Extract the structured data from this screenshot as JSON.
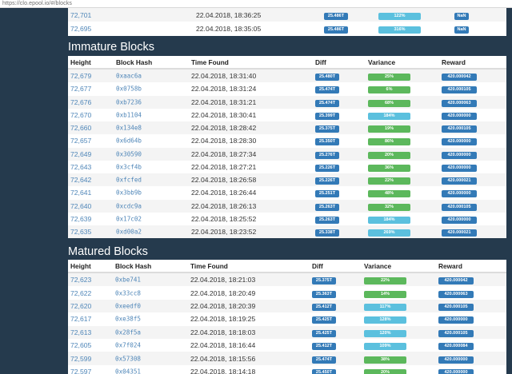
{
  "browser": {
    "url": "https://clo.epool.io/#/blocks"
  },
  "colors": {
    "variance_green": "#5cb85c",
    "variance_blue": "#5bc0de",
    "badge_blue": "#337ab7",
    "page_bg": "#253a4d"
  },
  "top_blocks": [
    {
      "height": "72,701",
      "time": "22.04.2018, 18:36:25",
      "diff": "25.486T",
      "variance": "122%",
      "variance_color": "#5bc0de",
      "reward": "NaN"
    },
    {
      "height": "72,695",
      "time": "22.04.2018, 18:35:05",
      "diff": "25.486T",
      "variance": "316%",
      "variance_color": "#5bc0de",
      "reward": "NaN"
    }
  ],
  "immature": {
    "title": "Immature Blocks",
    "headers": {
      "height": "Height",
      "hash": "Block Hash",
      "time": "Time Found",
      "diff": "Diff",
      "variance": "Variance",
      "reward": "Reward"
    },
    "rows": [
      {
        "height": "72,679",
        "hash": "0xaac6a",
        "time": "22.04.2018, 18:31:40",
        "diff": "25.480T",
        "variance": "25%",
        "variance_color": "#5cb85c",
        "reward": "420.000042"
      },
      {
        "height": "72,677",
        "hash": "0x0758b",
        "time": "22.04.2018, 18:31:24",
        "diff": "25.474T",
        "variance": "6%",
        "variance_color": "#5cb85c",
        "reward": "420.000105"
      },
      {
        "height": "72,676",
        "hash": "0xb7236",
        "time": "22.04.2018, 18:31:21",
        "diff": "25.474T",
        "variance": "68%",
        "variance_color": "#5cb85c",
        "reward": "420.000063"
      },
      {
        "height": "72,670",
        "hash": "0xb1104",
        "time": "22.04.2018, 18:30:41",
        "diff": "25.399T",
        "variance": "184%",
        "variance_color": "#5bc0de",
        "reward": "420.000000"
      },
      {
        "height": "72,660",
        "hash": "0x134e8",
        "time": "22.04.2018, 18:28:42",
        "diff": "25.375T",
        "variance": "19%",
        "variance_color": "#5cb85c",
        "reward": "420.000105"
      },
      {
        "height": "72,657",
        "hash": "0x6d64b",
        "time": "22.04.2018, 18:28:30",
        "diff": "25.350T",
        "variance": "86%",
        "variance_color": "#5cb85c",
        "reward": "420.000000"
      },
      {
        "height": "72,649",
        "hash": "0x30590",
        "time": "22.04.2018, 18:27:34",
        "diff": "25.276T",
        "variance": "20%",
        "variance_color": "#5cb85c",
        "reward": "420.000000"
      },
      {
        "height": "72,643",
        "hash": "0x3cf4b",
        "time": "22.04.2018, 18:27:21",
        "diff": "25.226T",
        "variance": "36%",
        "variance_color": "#5cb85c",
        "reward": "420.000000"
      },
      {
        "height": "72,642",
        "hash": "0xfcfed",
        "time": "22.04.2018, 18:26:58",
        "diff": "25.226T",
        "variance": "22%",
        "variance_color": "#5cb85c",
        "reward": "420.000021"
      },
      {
        "height": "72,641",
        "hash": "0x3bb9b",
        "time": "22.04.2018, 18:26:44",
        "diff": "25.251T",
        "variance": "48%",
        "variance_color": "#5cb85c",
        "reward": "420.000000"
      },
      {
        "height": "72,640",
        "hash": "0xcdc9a",
        "time": "22.04.2018, 18:26:13",
        "diff": "25.263T",
        "variance": "32%",
        "variance_color": "#5cb85c",
        "reward": "420.000105"
      },
      {
        "height": "72,639",
        "hash": "0x17c02",
        "time": "22.04.2018, 18:25:52",
        "diff": "25.263T",
        "variance": "184%",
        "variance_color": "#5bc0de",
        "reward": "420.000000"
      },
      {
        "height": "72,635",
        "hash": "0xd00a2",
        "time": "22.04.2018, 18:23:52",
        "diff": "25.338T",
        "variance": "269%",
        "variance_color": "#5bc0de",
        "reward": "420.000021"
      }
    ]
  },
  "matured": {
    "title": "Matured Blocks",
    "headers": {
      "height": "Height",
      "hash": "Block Hash",
      "time": "Time Found",
      "diff": "Diff",
      "variance": "Variance",
      "reward": "Reward"
    },
    "rows": [
      {
        "height": "72,623",
        "hash": "0xbe741",
        "time": "22.04.2018, 18:21:03",
        "diff": "25.375T",
        "variance": "22%",
        "variance_color": "#5cb85c",
        "reward": "420.000042"
      },
      {
        "height": "72,622",
        "hash": "0x33cc8",
        "time": "22.04.2018, 18:20:49",
        "diff": "25.363T",
        "variance": "14%",
        "variance_color": "#5cb85c",
        "reward": "420.000063"
      },
      {
        "height": "72,620",
        "hash": "0xeedf0",
        "time": "22.04.2018, 18:20:39",
        "diff": "25.412T",
        "variance": "117%",
        "variance_color": "#5bc0de",
        "reward": "420.000105"
      },
      {
        "height": "72,617",
        "hash": "0xe38f5",
        "time": "22.04.2018, 18:19:25",
        "diff": "25.425T",
        "variance": "128%",
        "variance_color": "#5bc0de",
        "reward": "420.000000"
      },
      {
        "height": "72,613",
        "hash": "0x28f5a",
        "time": "22.04.2018, 18:18:03",
        "diff": "25.425T",
        "variance": "120%",
        "variance_color": "#5bc0de",
        "reward": "420.000105"
      },
      {
        "height": "72,605",
        "hash": "0x7f024",
        "time": "22.04.2018, 18:16:44",
        "diff": "25.412T",
        "variance": "109%",
        "variance_color": "#5bc0de",
        "reward": "420.000084"
      },
      {
        "height": "72,599",
        "hash": "0x57308",
        "time": "22.04.2018, 18:15:56",
        "diff": "25.474T",
        "variance": "38%",
        "variance_color": "#5cb85c",
        "reward": "420.000000"
      },
      {
        "height": "72,597",
        "hash": "0x04351",
        "time": "22.04.2018, 18:14:18",
        "diff": "25.450T",
        "variance": "20%",
        "variance_color": "#5cb85c",
        "reward": "420.000000"
      }
    ]
  }
}
